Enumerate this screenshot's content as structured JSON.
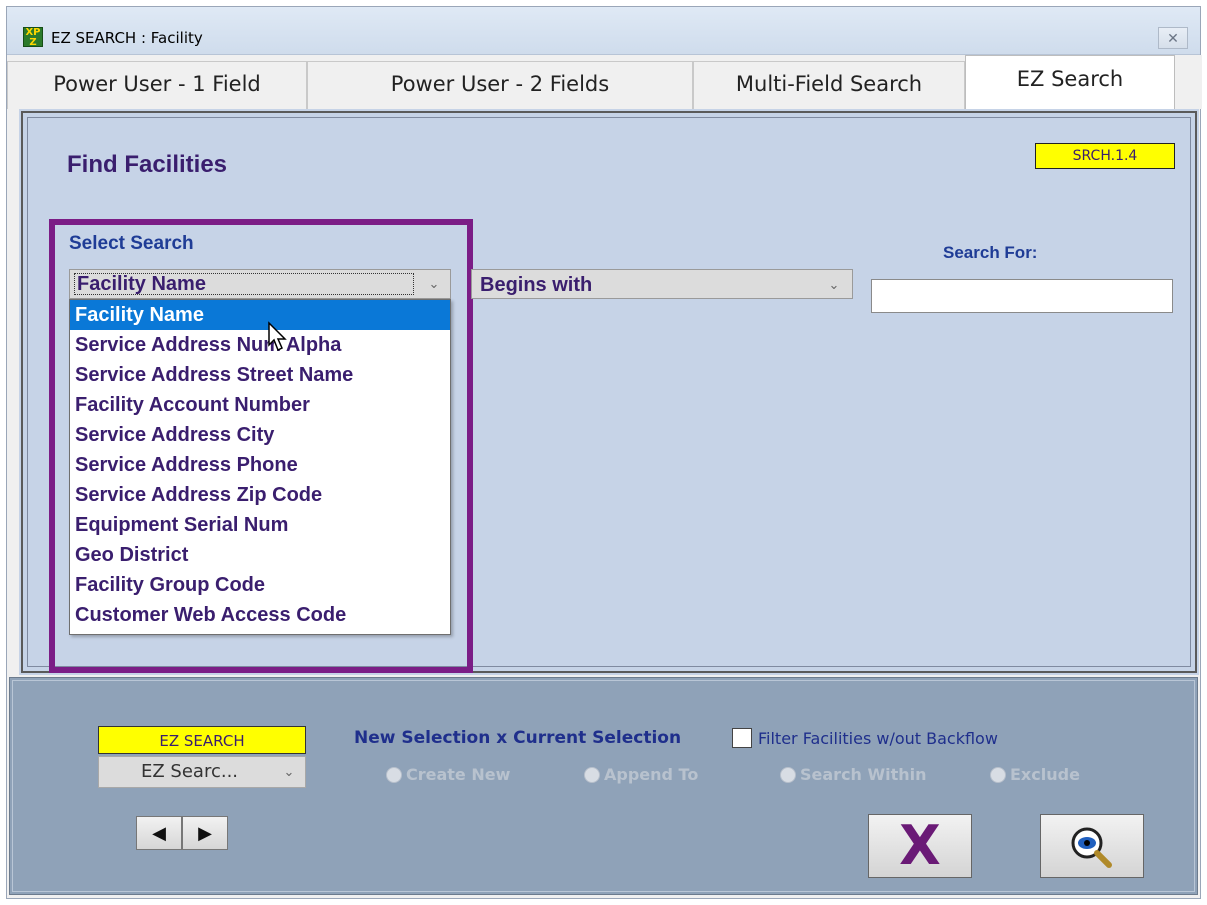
{
  "window": {
    "title": "EZ SEARCH : Facility",
    "icon_text": "XP Z",
    "close_label": "✕"
  },
  "tabs": [
    {
      "label": "Power User - 1 Field"
    },
    {
      "label": "Power User - 2 Fields"
    },
    {
      "label": "Multi-Field Search"
    },
    {
      "label": "EZ Search",
      "active": true
    }
  ],
  "main": {
    "title": "Find Facilities",
    "screen_code": "SRCH.1.4",
    "select_search_label": "Select Search",
    "field_select": {
      "value": "Facility Name",
      "options": [
        "Facility Name",
        "Service Address Num Alpha",
        "Service Address Street Name",
        "Facility Account Number",
        "Service Address City",
        "Service Address Phone",
        "Service Address Zip Code",
        "Equipment Serial Num",
        "Geo District",
        "Facility Group Code",
        "Customer Web Access Code"
      ],
      "highlighted": "Facility Name"
    },
    "operator_select": {
      "value": "Begins with"
    },
    "search_for_label": "Search For:",
    "search_for_value": ""
  },
  "bottom": {
    "ez_tag": "EZ SEARCH",
    "ez_select_value": "EZ Searc...",
    "nav_prev": "◀",
    "nav_next": "▶",
    "selection_label": "New Selection x Current Selection",
    "filter_label": "Filter Facilities w/out Backflow",
    "filter_checked": false,
    "radios": [
      "Create New",
      "Append To",
      "Search Within",
      "Exclude"
    ],
    "cancel_glyph": "X"
  },
  "colors": {
    "panel_bg": "#c6d3e7",
    "bottom_bg": "#8fa2b8",
    "highlight": "#0a78d7",
    "frame": "#7b1d86",
    "tag_yellow": "#ffff00",
    "text_purple": "#3a1e6e",
    "label_blue": "#1f3c96"
  }
}
